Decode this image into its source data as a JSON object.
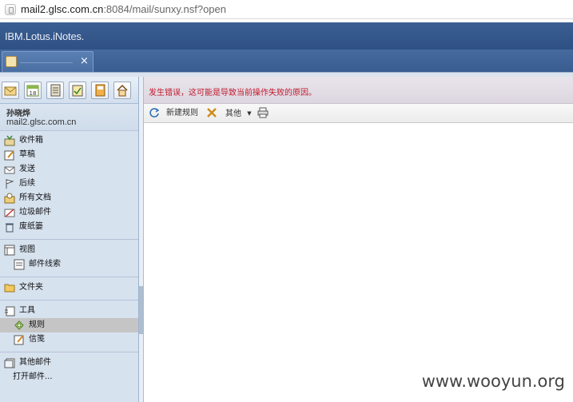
{
  "browser": {
    "url_host": "mail2.glsc.com.cn",
    "url_rest": ":8084/mail/sunxy.nsf?open"
  },
  "app": {
    "brand": "IBM.Lotus.iNotes."
  },
  "tabs": [
    {
      "close_glyph": "×"
    }
  ],
  "toolbar_left": {
    "icons": [
      "mail-icon",
      "calendar-icon",
      "contacts-icon",
      "todo-icon",
      "notebook-icon",
      "home-icon"
    ],
    "calendar_day": "18"
  },
  "user": {
    "name": "孙晓烨",
    "email": "mail2.glsc.com.cn"
  },
  "nav": {
    "mail_items": [
      {
        "label": "收件箱",
        "icon": "inbox-icon"
      },
      {
        "label": "草稿",
        "icon": "drafts-icon"
      },
      {
        "label": "发送",
        "icon": "sent-icon"
      },
      {
        "label": "后续",
        "icon": "followup-icon"
      },
      {
        "label": "所有文档",
        "icon": "all-documents-icon"
      },
      {
        "label": "垃圾邮件",
        "icon": "junk-icon"
      },
      {
        "label": "废纸篓",
        "icon": "trash-icon"
      }
    ],
    "views": {
      "label": "视图",
      "sub": "邮件线索"
    },
    "folders": {
      "label": "文件夹"
    },
    "tools": {
      "label": "工具",
      "rules": "规则",
      "stationery": "信笺"
    },
    "other_mail": {
      "label": "其他邮件",
      "open": "打开邮件..."
    }
  },
  "main": {
    "error": "发生错误，这可能是导致当前操作失败的原因。",
    "actions": {
      "new_rule": "新建规则",
      "other": "其他"
    }
  },
  "watermark": "www.wooyun.org",
  "colors": {
    "banner": "#2e5083",
    "error_text": "#c0192b",
    "sidebar": "#d7e2ef"
  }
}
